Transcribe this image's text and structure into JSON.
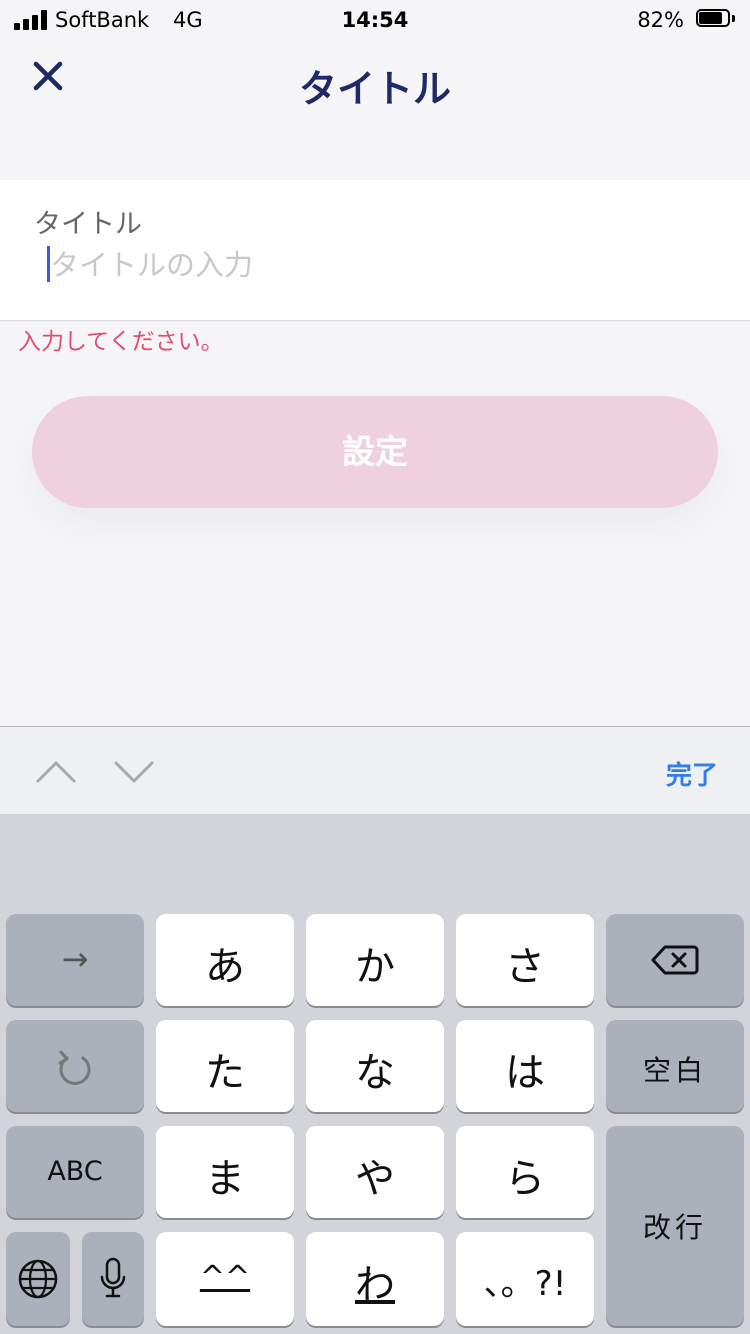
{
  "status_bar": {
    "carrier": "SoftBank",
    "network": "4G",
    "time": "14:54",
    "battery_percent": "82%",
    "battery_level": 0.82
  },
  "nav": {
    "title": "タイトル",
    "close_icon": "close-icon"
  },
  "form": {
    "label": "タイトル",
    "placeholder": "タイトルの入力",
    "value": "",
    "error": "入力してください。"
  },
  "submit": {
    "label": "設定",
    "enabled": false
  },
  "toolbar": {
    "prev_icon": "chevron-up-icon",
    "next_icon": "chevron-down-icon",
    "done_label": "完了"
  },
  "keyboard": {
    "row1": [
      "→",
      "あ",
      "か",
      "さ"
    ],
    "row2": [
      "た",
      "な",
      "は"
    ],
    "space_label": "空白",
    "row3": [
      "ABC",
      "ま",
      "や",
      "ら"
    ],
    "return_label": "改行",
    "row4": [
      "^^",
      "わ",
      "、。?!"
    ],
    "icons": [
      "backspace-icon",
      "undo-icon",
      "globe-icon",
      "microphone-icon"
    ]
  },
  "colors": {
    "title": "#1e2a66",
    "error": "#e04e6f",
    "button_disabled": "#efd0df",
    "accent": "#2f7fe6",
    "caret": "#3b5bdb"
  }
}
